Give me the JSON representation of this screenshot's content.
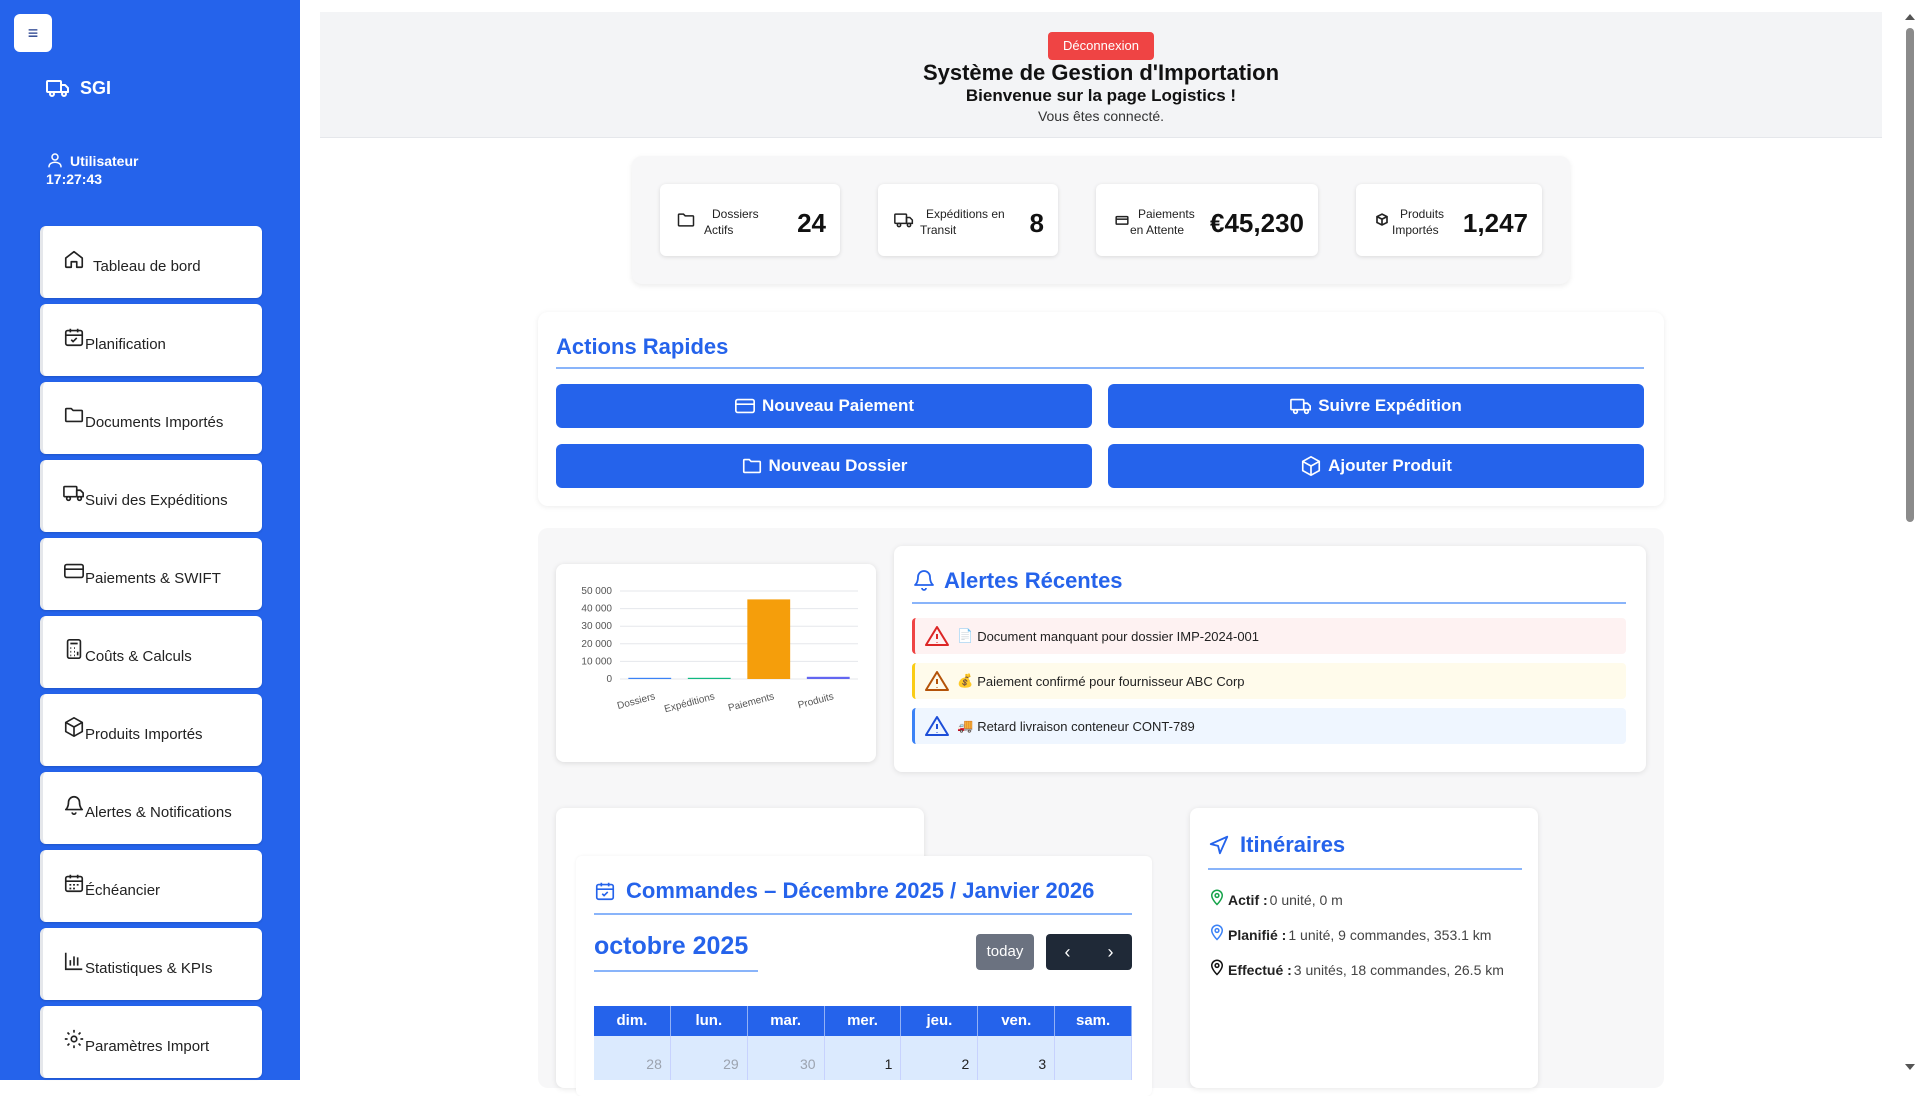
{
  "sidebar": {
    "toggle": "≡",
    "brand": "SGI",
    "user_name": "Utilisateur",
    "user_time": "17:27:43",
    "items": [
      {
        "label": "Tableau de bord",
        "icon": "home-icon"
      },
      {
        "label": "Planification",
        "icon": "calendar-check-icon"
      },
      {
        "label": "Documents Importés",
        "icon": "folder-icon"
      },
      {
        "label": "Suivi des Expéditions",
        "icon": "truck-icon"
      },
      {
        "label": "Paiements & SWIFT",
        "icon": "credit-card-icon"
      },
      {
        "label": "Coûts & Calculs",
        "icon": "calculator-icon"
      },
      {
        "label": "Produits Importés",
        "icon": "box-icon"
      },
      {
        "label": "Alertes & Notifications",
        "icon": "bell-icon"
      },
      {
        "label": "Échéancier",
        "icon": "calendar-icon"
      },
      {
        "label": "Statistiques & KPIs",
        "icon": "bar-chart-icon"
      },
      {
        "label": "Paramètres Import",
        "icon": "gear-icon"
      }
    ]
  },
  "header": {
    "logout": "Déconnexion",
    "title": "Système de Gestion d'Importation",
    "subtitle": "Bienvenue sur la page Logistics !",
    "status": "Vous êtes connecté."
  },
  "stats": [
    {
      "label_1": "Dossiers",
      "label_2": "Actifs",
      "value": "24"
    },
    {
      "label_1": "Expéditions en",
      "label_2": "Transit",
      "value": "8"
    },
    {
      "label_1": "Paiements",
      "label_2": "en Attente",
      "value": "€45,230"
    },
    {
      "label_1": "Produits",
      "label_2": "Importés",
      "value": "1,247"
    }
  ],
  "quick_actions": {
    "title": "Actions Rapides",
    "buttons": [
      "Nouveau Paiement",
      "Suivre Expédition",
      "Nouveau Dossier",
      "Ajouter Produit"
    ]
  },
  "chart_data": {
    "type": "bar",
    "categories": [
      "Dossiers",
      "Expéditions",
      "Paiements",
      "Produits"
    ],
    "values": [
      24,
      8,
      45230,
      1247
    ],
    "ylim": [
      0,
      50000
    ],
    "yticks": [
      "50 000",
      "40 000",
      "30 000",
      "20 000",
      "10 000",
      "0"
    ],
    "bar_colors": [
      "#3b82f6",
      "#10b981",
      "#f59e0b",
      "#6366f1"
    ],
    "grid": true,
    "title": "",
    "xlabel": "",
    "ylabel": ""
  },
  "alerts": {
    "title": "Alertes Récentes",
    "items": [
      {
        "emoji": "📄",
        "text": "Document manquant pour dossier IMP-2024-001",
        "bg": "#fef2f2",
        "border": "#ef4444",
        "icon_color": "#dc2626"
      },
      {
        "emoji": "💰",
        "text": "Paiement confirmé pour fournisseur ABC Corp",
        "bg": "#fffbeb",
        "border": "#facc15",
        "icon_color": "#b45309"
      },
      {
        "emoji": "🚚",
        "text": "Retard livraison conteneur CONT-789",
        "bg": "#eff6ff",
        "border": "#3b82f6",
        "icon_color": "#1d4ed8"
      }
    ]
  },
  "calendar": {
    "title": "Commandes – Décembre 2025 / Janvier 2026",
    "month": "octobre 2025",
    "today": "today",
    "prev": "‹",
    "next": "›",
    "weekdays": [
      "dim.",
      "lun.",
      "mar.",
      "mer.",
      "jeu.",
      "ven.",
      "sam."
    ],
    "first_week": [
      {
        "day": "28",
        "dim": true
      },
      {
        "day": "29",
        "dim": true
      },
      {
        "day": "30",
        "dim": true
      },
      {
        "day": "1",
        "dim": false
      },
      {
        "day": "2",
        "dim": false
      },
      {
        "day": "3",
        "dim": false
      },
      {
        "day": "",
        "dim": false
      }
    ]
  },
  "itineraries": {
    "title": "Itinéraires",
    "rows": [
      {
        "label": "Actif :",
        "value": "0 unité, 0 m",
        "color": "#16a34a"
      },
      {
        "label": "Planifié :",
        "value": "1 unité, 9 commandes, 353.1 km",
        "color": "#3b82f6"
      },
      {
        "label": "Effectué :",
        "value": "3 unités, 18 commandes, 26.5 km",
        "color": "#111111"
      }
    ]
  },
  "colors": {
    "primary": "#2563eb",
    "danger": "#ef4444",
    "chart_accent": "#f59e0b"
  }
}
